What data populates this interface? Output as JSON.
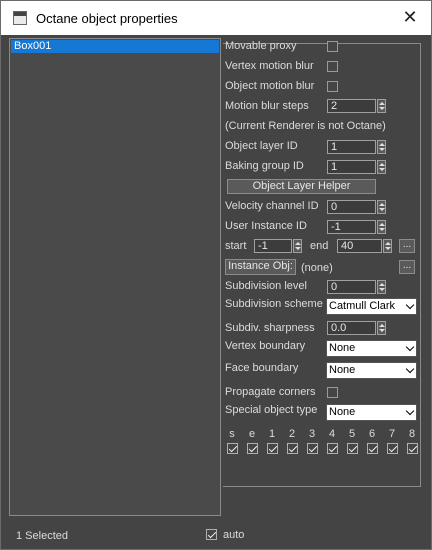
{
  "window": {
    "title": "Octane object properties",
    "close_glyph": "✕"
  },
  "object_list": {
    "items": [
      "Box001"
    ],
    "selected_index": 0
  },
  "labels": {
    "movable_proxy": "Movable proxy",
    "vertex_motion_blur": "Vertex motion blur",
    "object_motion_blur": "Object motion blur",
    "motion_blur_steps": "Motion blur steps",
    "renderer_note": "(Current Renderer is not Octane)",
    "object_layer_id": "Object layer ID",
    "baking_group_id": "Baking group ID",
    "velocity_channel_id": "Velocity channel ID",
    "user_instance_id": "User Instance ID",
    "start": "start",
    "end": "end",
    "instance_obj_value": "(none)",
    "subdivision_level": "Subdivision level",
    "subdivision_scheme": "Subdivision scheme",
    "subdiv_sharpness": "Subdiv. sharpness",
    "vertex_boundary": "Vertex boundary",
    "face_boundary": "Face boundary",
    "propagate_corners": "Propagate corners",
    "special_object_type": "Special object type"
  },
  "values": {
    "motion_blur_steps": "2",
    "object_layer_id": "1",
    "baking_group_id": "1",
    "velocity_channel_id": "0",
    "user_instance_id": "-1",
    "start": "-1",
    "end": "40",
    "subdivision_level": "0",
    "subdiv_sharpness": "0.0",
    "subdivision_scheme": "Catmull Clark",
    "vertex_boundary": "None",
    "face_boundary": "None",
    "special_object_type": "None"
  },
  "buttons": {
    "object_layer_helper": "Object Layer Helper",
    "instance_obj": "Instance Obj:",
    "browse": "..."
  },
  "checkboxes": {
    "movable_proxy": false,
    "vertex_motion_blur": false,
    "object_motion_blur": false,
    "propagate_corners": false
  },
  "flags": [
    {
      "label": "s",
      "checked": true
    },
    {
      "label": "e",
      "checked": true
    },
    {
      "label": "1",
      "checked": true
    },
    {
      "label": "2",
      "checked": true
    },
    {
      "label": "3",
      "checked": true
    },
    {
      "label": "4",
      "checked": true
    },
    {
      "label": "5",
      "checked": true
    },
    {
      "label": "6",
      "checked": true
    },
    {
      "label": "7",
      "checked": true
    },
    {
      "label": "8",
      "checked": true
    }
  ],
  "footer": {
    "status": "1 Selected",
    "auto_label": "auto",
    "auto_checked": true
  }
}
